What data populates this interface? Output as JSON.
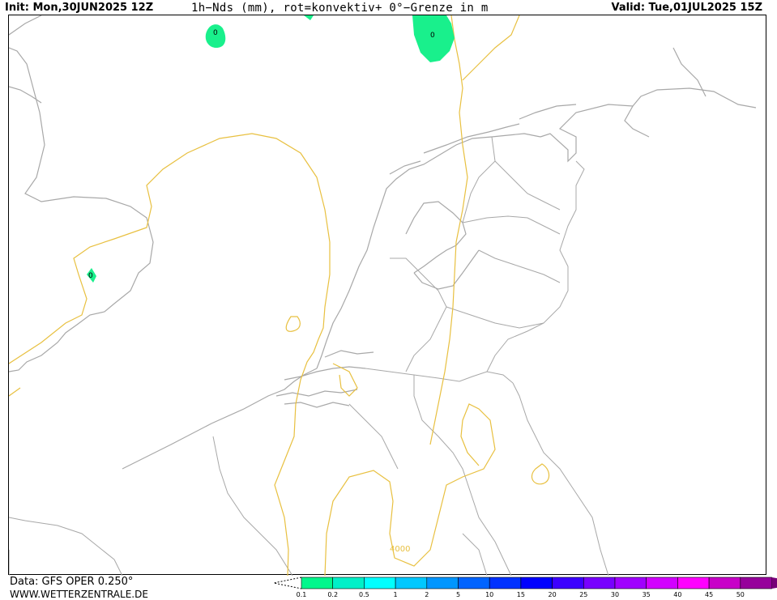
{
  "header": {
    "init": "Init: Mon,30JUN2025 12Z",
    "title": "1h−Nds (mm), rot=konvektiv+ 0°−Grenze in m",
    "valid": "Valid: Tue,01JUL2025 15Z"
  },
  "footer": {
    "data_source": "Data: GFS OPER 0.250°",
    "website": "WWW.WETTERZENTRALE.DE"
  },
  "map": {
    "coast_color": "#a8a8a8",
    "contour_color": "#e8c040",
    "contour_label": "4000",
    "precip_color": "#19f08c",
    "precip_marks": [
      {
        "label": "0",
        "value_mm": 0.1
      },
      {
        "label": "0",
        "value_mm": 0.1
      },
      {
        "label": "0",
        "value_mm": 0.2
      }
    ]
  },
  "legend": {
    "labels": [
      "0.1",
      "0.2",
      "0.5",
      "1",
      "2",
      "5",
      "10",
      "15",
      "20",
      "25",
      "30",
      "35",
      "40",
      "45",
      "50"
    ],
    "colors": [
      "#00f78c",
      "#00f0c8",
      "#00ffff",
      "#00c8ff",
      "#0096ff",
      "#0064ff",
      "#0032ff",
      "#0000ff",
      "#3c00ff",
      "#7800ff",
      "#a000ff",
      "#d200ff",
      "#ff00ff",
      "#c800c8",
      "#96009b",
      "#780078"
    ]
  }
}
